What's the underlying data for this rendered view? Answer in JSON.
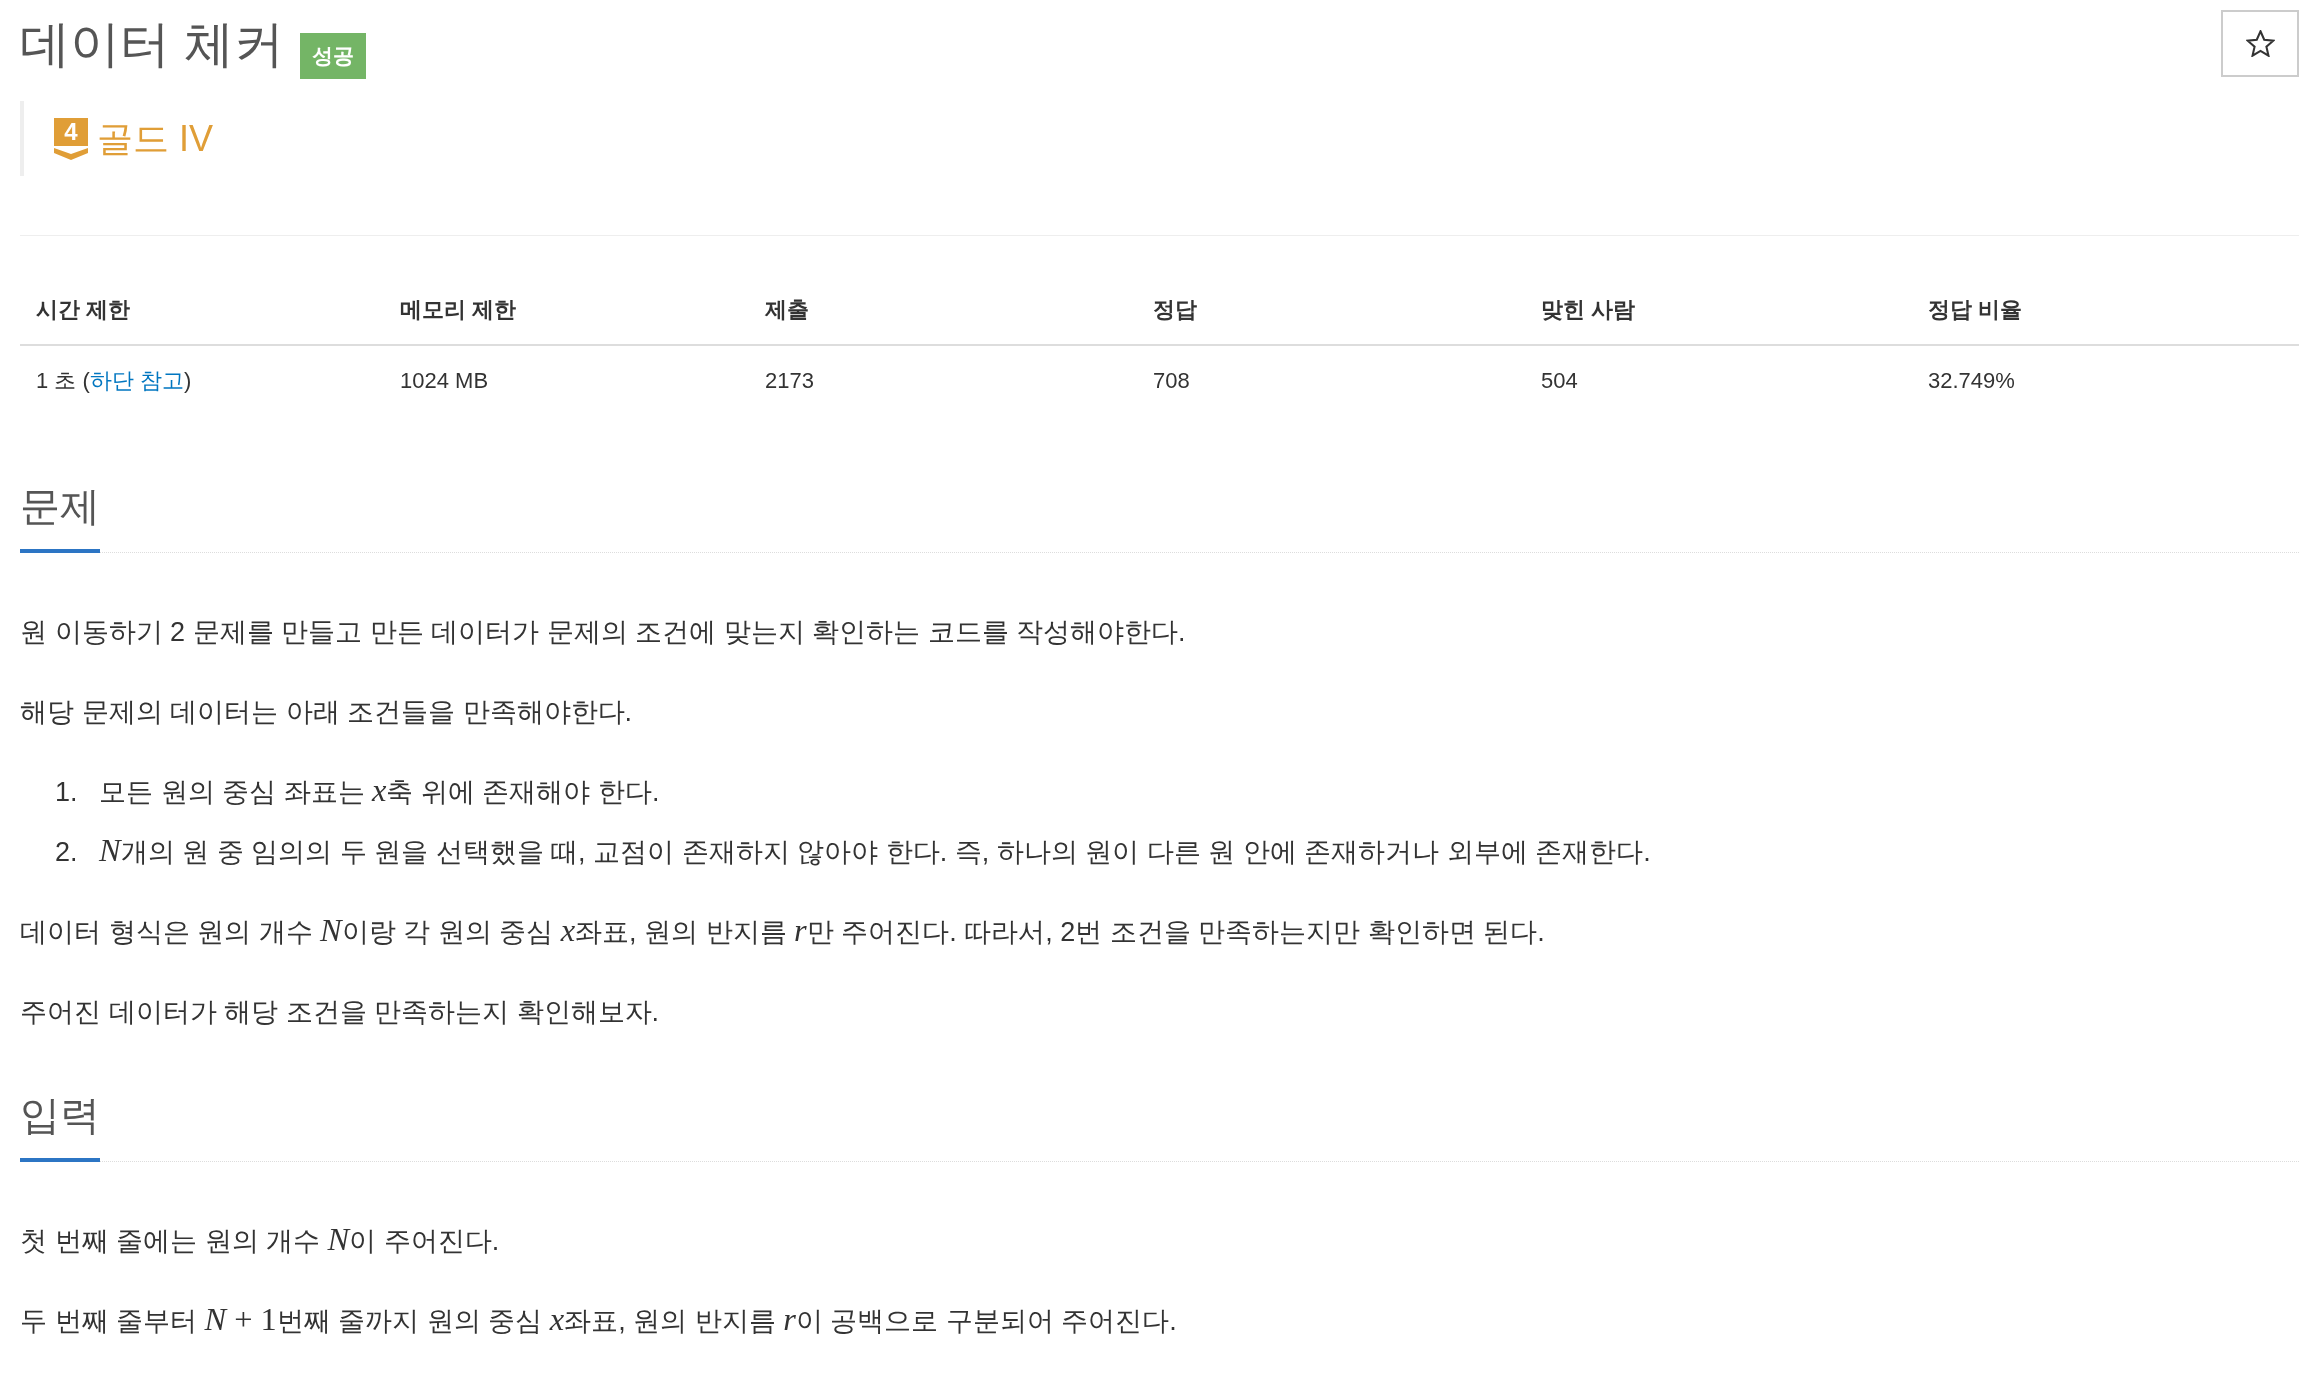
{
  "title": {
    "text": "데이터 체커",
    "status_badge": "성공"
  },
  "favorite_button": {
    "starred": false
  },
  "tier": {
    "number": "4",
    "label": "골드 IV"
  },
  "stats_table": {
    "columns": [
      "시간 제한",
      "메모리 제한",
      "제출",
      "정답",
      "맞힌 사람",
      "정답 비율"
    ],
    "rows": [
      [
        {
          "parts": [
            {
              "kind": "text",
              "text": "1 초 ("
            },
            {
              "kind": "link",
              "text": "하단 참고"
            },
            {
              "kind": "text",
              "text": ")"
            }
          ]
        },
        "1024 MB",
        "2173",
        "708",
        "504",
        "32.749%"
      ]
    ]
  },
  "sections": [
    {
      "title": "문제",
      "blocks": [
        {
          "kind": "paragraph",
          "parts": [
            {
              "kind": "text",
              "text": "원 이동하기 2 문제를 만들고 만든 데이터가 문제의 조건에 맞는지 확인하는 코드를 작성해야한다."
            }
          ]
        },
        {
          "kind": "paragraph",
          "parts": [
            {
              "kind": "text",
              "text": "해당 문제의 데이터는 아래 조건들을 만족해야한다."
            }
          ]
        },
        {
          "kind": "list",
          "items": [
            {
              "number": "1.",
              "parts": [
                {
                  "kind": "text",
                  "text": "모든 원의 중심 좌표는 "
                },
                {
                  "kind": "var",
                  "text": "x"
                },
                {
                  "kind": "text",
                  "text": "축 위에 존재해야 한다."
                }
              ]
            },
            {
              "number": "2.",
              "parts": [
                {
                  "kind": "var",
                  "text": "N"
                },
                {
                  "kind": "text",
                  "text": "개의 원 중 임의의 두 원을 선택했을 때, 교점이 존재하지 않아야 한다. 즉, 하나의 원이 다른 원 안에 존재하거나 외부에 존재한다."
                }
              ]
            }
          ]
        },
        {
          "kind": "paragraph",
          "parts": [
            {
              "kind": "text",
              "text": "데이터 형식은 원의 개수 "
            },
            {
              "kind": "var",
              "text": "N"
            },
            {
              "kind": "text",
              "text": "이랑 각 원의 중심 "
            },
            {
              "kind": "var",
              "text": "x"
            },
            {
              "kind": "text",
              "text": "좌표, 원의 반지름 "
            },
            {
              "kind": "var",
              "text": "r"
            },
            {
              "kind": "text",
              "text": "만 주어진다. 따라서, 2번 조건을 만족하는지만 확인하면 된다."
            }
          ]
        },
        {
          "kind": "paragraph",
          "parts": [
            {
              "kind": "text",
              "text": "주어진 데이터가 해당 조건을 만족하는지 확인해보자."
            }
          ]
        }
      ]
    },
    {
      "title": "입력",
      "blocks": [
        {
          "kind": "paragraph",
          "parts": [
            {
              "kind": "text",
              "text": "첫 번째 줄에는 원의 개수 "
            },
            {
              "kind": "var",
              "text": "N"
            },
            {
              "kind": "text",
              "text": "이 주어진다."
            }
          ]
        },
        {
          "kind": "paragraph",
          "parts": [
            {
              "kind": "text",
              "text": "두 번째 줄부터 "
            },
            {
              "kind": "var",
              "text": "N"
            },
            {
              "kind": "op",
              "text": "+"
            },
            {
              "kind": "num",
              "text": "1"
            },
            {
              "kind": "text",
              "text": "번째 줄까지 원의 중심 "
            },
            {
              "kind": "var",
              "text": "x"
            },
            {
              "kind": "text",
              "text": "좌표, 원의 반지름 "
            },
            {
              "kind": "var",
              "text": "r"
            },
            {
              "kind": "text",
              "text": "이 공백으로 구분되어 주어진다."
            }
          ]
        }
      ]
    }
  ]
}
